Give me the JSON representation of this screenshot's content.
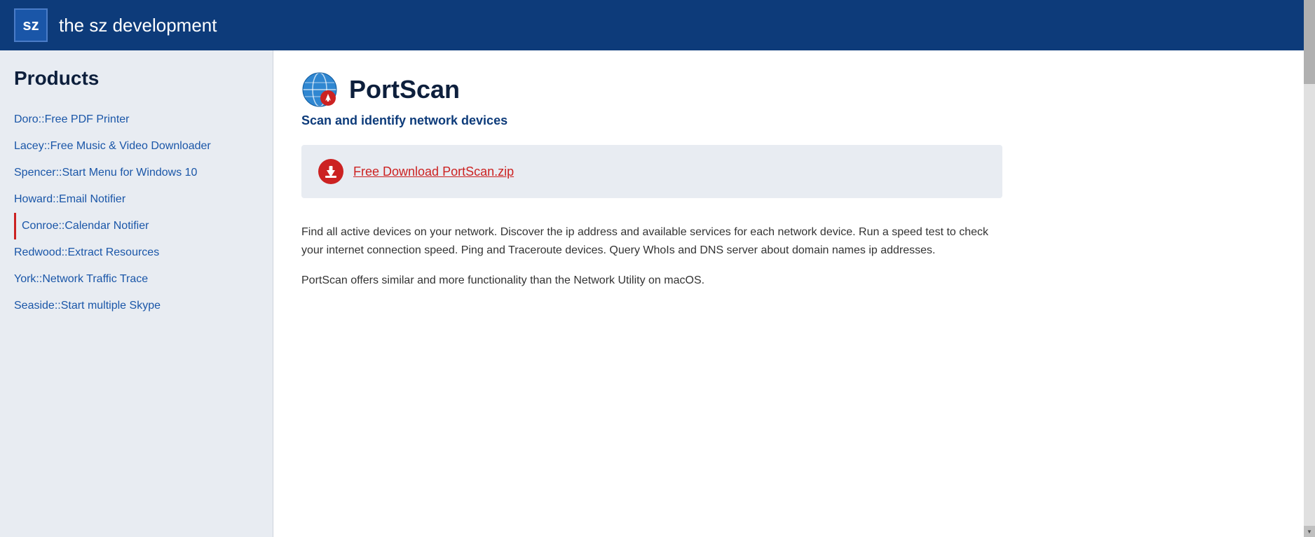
{
  "header": {
    "logo_text": "sz",
    "title": "the sz development"
  },
  "sidebar": {
    "heading": "Products",
    "items": [
      {
        "id": "doro",
        "label": "Doro::Free PDF Printer",
        "active": false
      },
      {
        "id": "lacey",
        "label": "Lacey::Free Music & Video Downloader",
        "active": false
      },
      {
        "id": "spencer",
        "label": "Spencer::Start Menu for Windows 10",
        "active": false
      },
      {
        "id": "howard",
        "label": "Howard::Email Notifier",
        "active": false
      },
      {
        "id": "conroe",
        "label": "Conroe::Calendar Notifier",
        "active": true
      },
      {
        "id": "redwood",
        "label": "Redwood::Extract Resources",
        "active": false
      },
      {
        "id": "york",
        "label": "York::Network Traffic Trace",
        "active": false
      },
      {
        "id": "seaside",
        "label": "Seaside::Start multiple Skype",
        "active": false
      }
    ]
  },
  "content": {
    "product_title": "PortScan",
    "product_subtitle": "Scan and identify network devices",
    "download_label": "Free Download PortScan.zip",
    "description_1": "Find all active devices on your network. Discover the ip address and available services for each network device. Run a speed test to check your internet connection speed. Ping and Traceroute devices. Query WhoIs and DNS server about domain names ip addresses.",
    "description_2": "PortScan offers similar and more functionality than the Network Utility on macOS."
  }
}
